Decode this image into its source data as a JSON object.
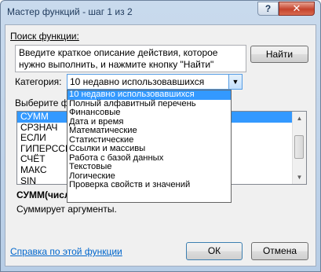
{
  "window": {
    "title": "Мастер функций - шаг 1 из 2",
    "help_glyph": "?",
    "close_glyph": "✕"
  },
  "search": {
    "label": "Поиск функции:",
    "value": "Введите краткое описание действия, которое нужно выполнить, и нажмите кнопку \"Найти\"",
    "find_button": "Найти"
  },
  "category": {
    "label": "Категория:",
    "selected": "10 недавно использовавшихся",
    "options": [
      "10 недавно использовавшихся",
      "Полный алфавитный перечень",
      "Финансовые",
      "Дата и время",
      "Математические",
      "Статистические",
      "Ссылки и массивы",
      "Работа с базой данных",
      "Текстовые",
      "Логические",
      "Проверка свойств и значений"
    ]
  },
  "functions": {
    "label": "Выберите фун",
    "items": [
      "СУММ",
      "СРЗНАЧ",
      "ЕСЛИ",
      "ГИПЕРССЫЛ",
      "СЧЁТ",
      "МАКС",
      "SIN"
    ],
    "selected_index": 0
  },
  "description": {
    "signature": "СУММ(числ",
    "text": "Суммирует аргументы."
  },
  "footer": {
    "help_link": "Справка по этой функции",
    "ok_button": "ОК",
    "cancel_button": "Отмена"
  }
}
